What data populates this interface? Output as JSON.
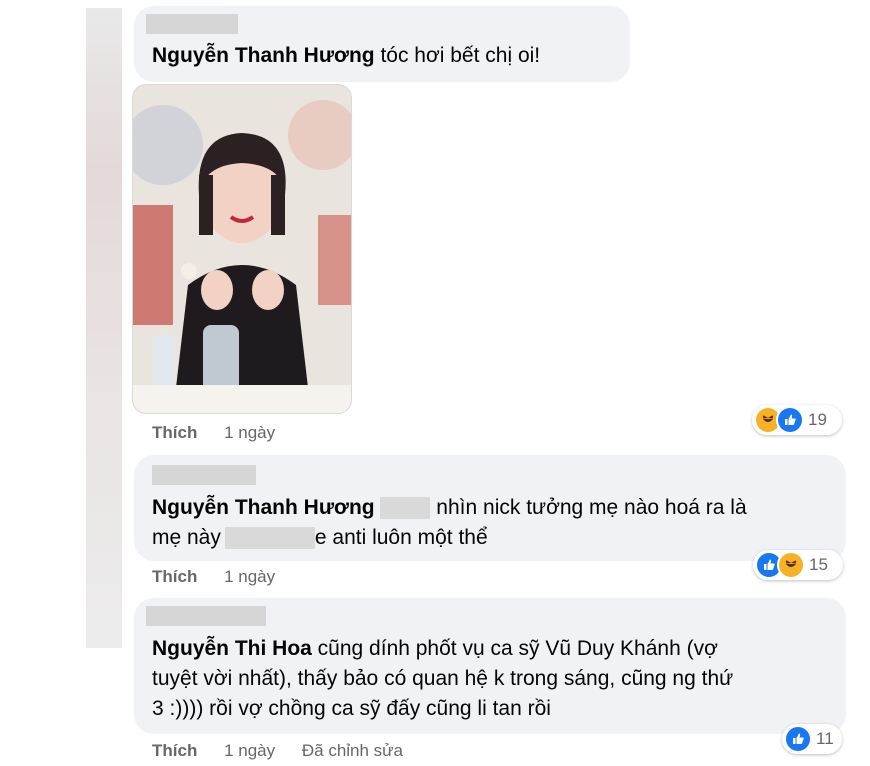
{
  "comments": [
    {
      "author": "Nguyễn Thanh Hương",
      "text": " tóc hơi bết chị oi!",
      "like_label": "Thích",
      "time": "1 ngày",
      "reaction_count": "19"
    },
    {
      "author": "Nguyễn Thanh Hương",
      "text_part1": " nhìn nick tưởng mẹ nào hoá ra là",
      "text_part2": "mẹ này",
      "text_part3": "e anti luôn một thể",
      "like_label": "Thích",
      "time": "1 ngày",
      "reaction_count": "15"
    },
    {
      "author": "Nguyễn Thi Hoa",
      "text_line1": " cũng dính phốt vụ ca sỹ Vũ Duy Khánh (vợ",
      "text_line2": "tuyệt vời nhất), thấy bảo có quan hệ k trong sáng, cũng ng thứ",
      "text_line3": "3 :)))) rồi vợ chồng ca sỹ đấy cũng li tan rồi",
      "like_label": "Thích",
      "time": "1 ngày",
      "edited": "Đã chỉnh sửa",
      "reaction_count": "11"
    }
  ],
  "icons": {
    "like": "like-icon",
    "haha": "haha-icon"
  },
  "colors": {
    "bubble": "#f0f2f5",
    "like_blue": "#1877f2",
    "haha_yellow": "#f7b125",
    "meta": "#65676b"
  }
}
